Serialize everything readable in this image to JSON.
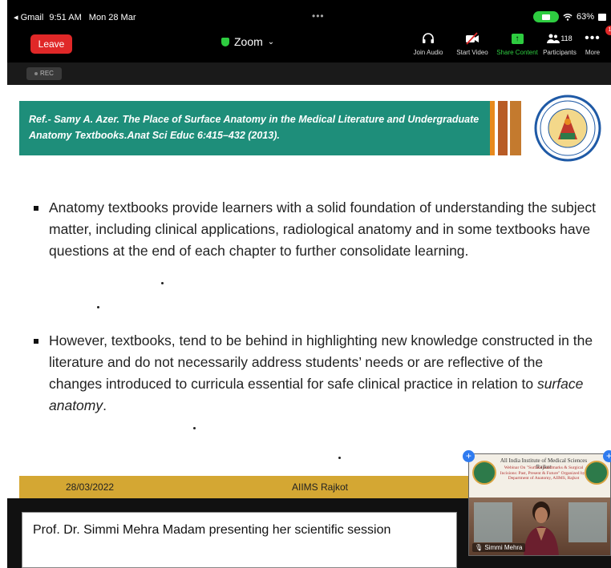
{
  "status_bar": {
    "back_app": "◂ Gmail",
    "time": "9:51 AM",
    "date": "Mon 28 Mar",
    "dots": "•••",
    "battery": "63%"
  },
  "toolbar": {
    "leave_label": "Leave",
    "app_title": "Zoom",
    "join_audio_label": "Join Audio",
    "start_video_label": "Start Video",
    "share_content_label": "Share Content",
    "participants_label": "Participants",
    "participants_count": "118",
    "more_label": "More",
    "more_badge": "1"
  },
  "rec": {
    "label": "REC"
  },
  "slide": {
    "reference": "Ref.- Samy A. Azer. The Place of Surface Anatomy in the Medical Literature and Undergraduate Anatomy Textbooks.Anat Sci Educ 6:415–432 (2013).",
    "bullets": [
      "Anatomy textbooks provide learners with a solid foundation of understanding the subject matter, including clinical applications, radiological anatomy and in some textbooks have questions at the end of each chapter to further consolidate learning.",
      "However, textbooks, tend to be behind in highlighting new knowledge constructed in the literature and do not necessarily address students’ needs or are reflective of the changes introduced to curricula essential for safe clinical practice in relation to"
    ],
    "bullet2_emphasis": "surface anatomy",
    "bullet2_end": ".",
    "footer_date": "28/03/2022",
    "footer_org": "AIIMS Rajkot"
  },
  "caption": "Prof. Dr. Simmi Mehra Madam presenting her scientific session",
  "video_tile": {
    "slide_title": "All India Institute of Medical Sciences Rajkot",
    "slide_subtitle": "Webinar On \"Surface Landmarks & Surgical Incisions: Past, Present & Future\" Organized by : Department of Anatomy, AIIMS, Rajkot",
    "name": "Simmi Mehra"
  },
  "colors": {
    "banner": "#1e8e7a",
    "footer": "#d4a733",
    "leave": "#e02828",
    "share": "#2ecc40"
  }
}
